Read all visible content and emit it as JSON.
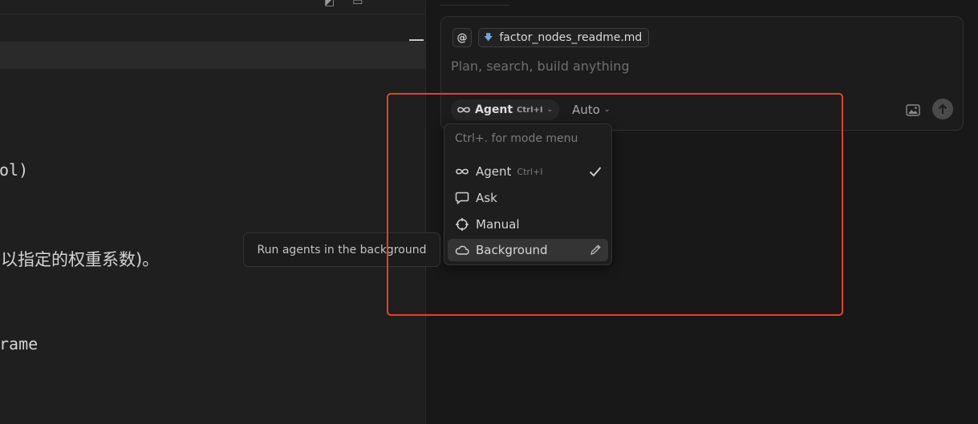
{
  "editor": {
    "code_lines": [
      "ol)",
      "rame"
    ],
    "text_line": "以指定的权重系数)。"
  },
  "composer": {
    "at_label": "@",
    "file_chip": "factor_nodes_readme.md",
    "placeholder": "Plan, search, build anything",
    "mode": {
      "name": "Agent",
      "shortcut": "Ctrl+I"
    },
    "model": "Auto"
  },
  "mode_menu": {
    "hint": "Ctrl+. for mode menu",
    "items": [
      {
        "label": "Agent",
        "shortcut": "Ctrl+I",
        "icon": "infinity-icon",
        "checked": true
      },
      {
        "label": "Ask",
        "icon": "chat-bubble-icon"
      },
      {
        "label": "Manual",
        "icon": "crosshair-icon"
      },
      {
        "label": "Background",
        "icon": "cloud-icon",
        "highlighted": true
      }
    ]
  },
  "tooltip": "Run agents in the background",
  "colors": {
    "highlight_box": "#e0442a",
    "panel_bg": "#181818",
    "editor_bg": "#1f1f1f"
  }
}
